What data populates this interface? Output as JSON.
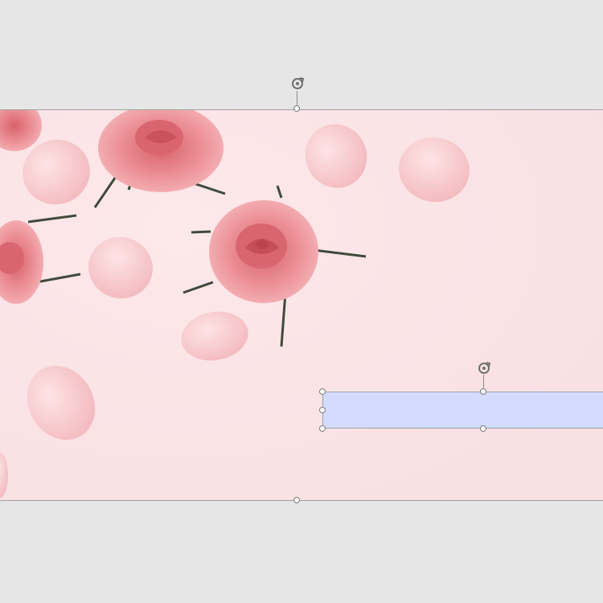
{
  "colors": {
    "workspace_bg": "#e6e6e6",
    "slide_bg": "#fbe3e6",
    "textbox_fill": "#d3dcff",
    "rose_dark": "#e27f87",
    "rose_light": "#f6b9bd",
    "petal": "#f8c9cc",
    "leaf": "#3f4a3a"
  },
  "icons": {
    "rotate_handle": "rotate-icon"
  },
  "textbox": {
    "text": ""
  }
}
